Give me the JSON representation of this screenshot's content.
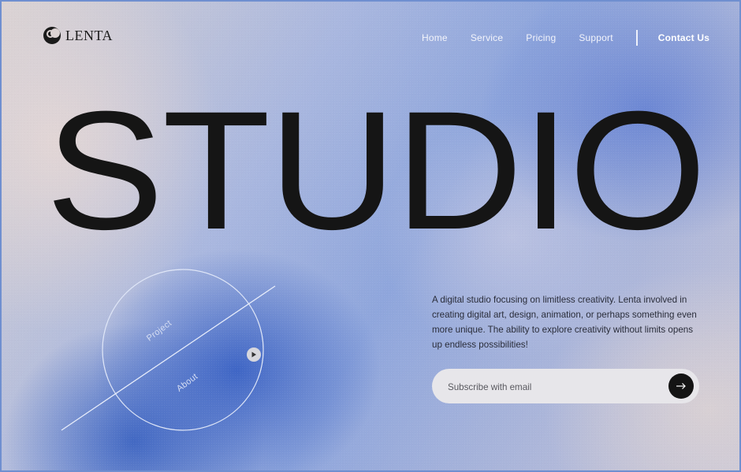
{
  "brand": {
    "name": "LENTA"
  },
  "nav": {
    "items": [
      "Home",
      "Service",
      "Pricing",
      "Support"
    ],
    "contact": "Contact Us"
  },
  "hero": {
    "title": "STUDIO"
  },
  "description": "A digital studio focusing on limitless creativity. Lenta involved in creating digital art, design, animation, or perhaps something even more unique. The ability to explore creativity without limits opens up endless possibilities!",
  "subscribe": {
    "placeholder": "Subscribe with email",
    "icon": "arrow-right-icon"
  },
  "orbit": {
    "labels": [
      "Project",
      "About"
    ],
    "icon": "play-icon"
  },
  "colors": {
    "text": "#151515",
    "accent_blue": "#3a62c4",
    "button": "#141414"
  }
}
